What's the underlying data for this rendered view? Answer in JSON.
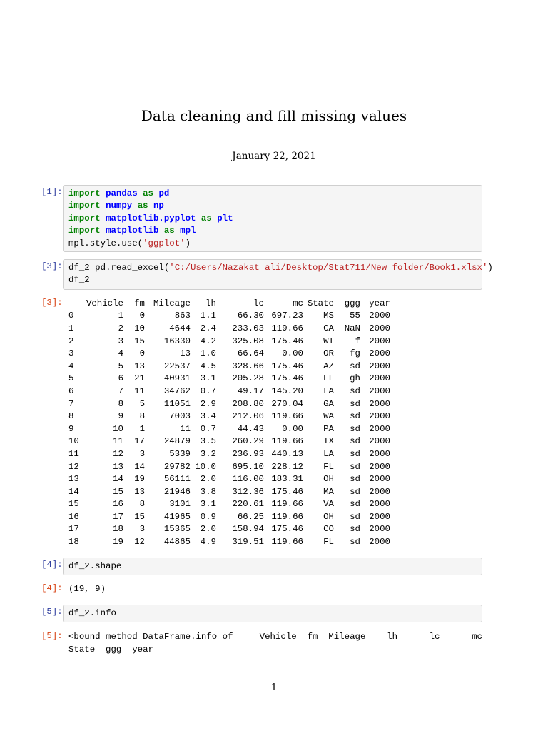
{
  "title": "Data cleaning and fill missing values",
  "date": "January 22, 2021",
  "cells": [
    {
      "prompt": "[1]:",
      "lines": [
        [
          {
            "t": "import",
            "c": "kw"
          },
          {
            "t": " "
          },
          {
            "t": "pandas",
            "c": "nm"
          },
          {
            "t": " "
          },
          {
            "t": "as",
            "c": "kw"
          },
          {
            "t": " "
          },
          {
            "t": "pd",
            "c": "nm"
          }
        ],
        [
          {
            "t": "import",
            "c": "kw"
          },
          {
            "t": " "
          },
          {
            "t": "numpy",
            "c": "nm"
          },
          {
            "t": " "
          },
          {
            "t": "as",
            "c": "kw"
          },
          {
            "t": " "
          },
          {
            "t": "np",
            "c": "nm"
          }
        ],
        [
          {
            "t": "import",
            "c": "kw"
          },
          {
            "t": " "
          },
          {
            "t": "matplotlib.pyplot",
            "c": "nm"
          },
          {
            "t": " "
          },
          {
            "t": "as",
            "c": "kw"
          },
          {
            "t": " "
          },
          {
            "t": "plt",
            "c": "nm"
          }
        ],
        [
          {
            "t": "import",
            "c": "kw"
          },
          {
            "t": " "
          },
          {
            "t": "matplotlib",
            "c": "nm"
          },
          {
            "t": " "
          },
          {
            "t": "as",
            "c": "kw"
          },
          {
            "t": " "
          },
          {
            "t": "mpl",
            "c": "nm"
          }
        ],
        [
          {
            "t": "mpl.style.use("
          },
          {
            "t": "'ggplot'",
            "c": "st"
          },
          {
            "t": ")"
          }
        ]
      ]
    },
    {
      "prompt": "[3]:",
      "lines": [
        [
          {
            "t": "df_2=pd.read_excel("
          },
          {
            "t": "'C:/Users/Nazakat ali/Desktop/Stat711/New folder/Book1.xlsx'",
            "c": "st"
          },
          {
            "t": ")"
          }
        ],
        [
          {
            "t": "df_2"
          }
        ]
      ]
    },
    {
      "prompt": "[4]:",
      "lines": [
        [
          {
            "t": "df_2.shape"
          }
        ]
      ]
    },
    {
      "prompt": "[5]:",
      "lines": [
        [
          {
            "t": "df_2.info"
          }
        ]
      ]
    }
  ],
  "outputs": {
    "out3_prompt": "[3]:",
    "out4_prompt": "[4]:",
    "out4_text": "(19, 9)",
    "out5_prompt": "[5]:",
    "out5_line1": "<bound method DataFrame.info of     Vehicle  fm  Mileage    lh      lc      mc",
    "out5_line2": "State  ggg  year"
  },
  "table": {
    "columns": [
      "",
      "Vehicle",
      "fm",
      "Mileage",
      "lh",
      "lc",
      "mc",
      "State",
      "ggg",
      "year"
    ],
    "rows": [
      [
        "0",
        "1",
        "0",
        "863",
        "1.1",
        "66.30",
        "697.23",
        "MS",
        "55",
        "2000"
      ],
      [
        "1",
        "2",
        "10",
        "4644",
        "2.4",
        "233.03",
        "119.66",
        "CA",
        "NaN",
        "2000"
      ],
      [
        "2",
        "3",
        "15",
        "16330",
        "4.2",
        "325.08",
        "175.46",
        "WI",
        "f",
        "2000"
      ],
      [
        "3",
        "4",
        "0",
        "13",
        "1.0",
        "66.64",
        "0.00",
        "OR",
        "fg",
        "2000"
      ],
      [
        "4",
        "5",
        "13",
        "22537",
        "4.5",
        "328.66",
        "175.46",
        "AZ",
        "sd",
        "2000"
      ],
      [
        "5",
        "6",
        "21",
        "40931",
        "3.1",
        "205.28",
        "175.46",
        "FL",
        "gh",
        "2000"
      ],
      [
        "6",
        "7",
        "11",
        "34762",
        "0.7",
        "49.17",
        "145.20",
        "LA",
        "sd",
        "2000"
      ],
      [
        "7",
        "8",
        "5",
        "11051",
        "2.9",
        "208.80",
        "270.04",
        "GA",
        "sd",
        "2000"
      ],
      [
        "8",
        "9",
        "8",
        "7003",
        "3.4",
        "212.06",
        "119.66",
        "WA",
        "sd",
        "2000"
      ],
      [
        "9",
        "10",
        "1",
        "11",
        "0.7",
        "44.43",
        "0.00",
        "PA",
        "sd",
        "2000"
      ],
      [
        "10",
        "11",
        "17",
        "24879",
        "3.5",
        "260.29",
        "119.66",
        "TX",
        "sd",
        "2000"
      ],
      [
        "11",
        "12",
        "3",
        "5339",
        "3.2",
        "236.93",
        "440.13",
        "LA",
        "sd",
        "2000"
      ],
      [
        "12",
        "13",
        "14",
        "29782",
        "10.0",
        "695.10",
        "228.12",
        "FL",
        "sd",
        "2000"
      ],
      [
        "13",
        "14",
        "19",
        "56111",
        "2.0",
        "116.00",
        "183.31",
        "OH",
        "sd",
        "2000"
      ],
      [
        "14",
        "15",
        "13",
        "21946",
        "3.8",
        "312.36",
        "175.46",
        "MA",
        "sd",
        "2000"
      ],
      [
        "15",
        "16",
        "8",
        "3101",
        "3.1",
        "220.61",
        "119.66",
        "VA",
        "sd",
        "2000"
      ],
      [
        "16",
        "17",
        "15",
        "41965",
        "0.9",
        "66.25",
        "119.66",
        "OH",
        "sd",
        "2000"
      ],
      [
        "17",
        "18",
        "3",
        "15365",
        "2.0",
        "158.94",
        "175.46",
        "CO",
        "sd",
        "2000"
      ],
      [
        "18",
        "19",
        "12",
        "44865",
        "4.9",
        "319.51",
        "119.66",
        "FL",
        "sd",
        "2000"
      ]
    ]
  },
  "page_number": "1"
}
